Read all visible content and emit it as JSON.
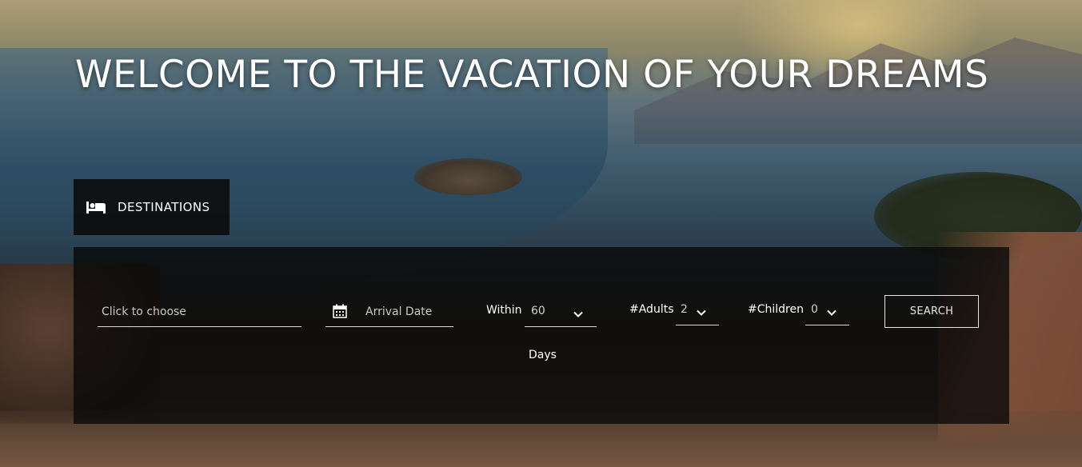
{
  "hero": {
    "title": "WELCOME TO THE VACATION OF YOUR DREAMS"
  },
  "tabs": [
    {
      "label": "DESTINATIONS",
      "icon": "bed-icon"
    }
  ],
  "search_form": {
    "destination": {
      "placeholder": "Click to choose",
      "value": ""
    },
    "arrival_date": {
      "placeholder": "Arrival Date",
      "value": "",
      "icon": "calendar-icon"
    },
    "within": {
      "label": "Within",
      "selected": "60",
      "suffix": "Days"
    },
    "adults": {
      "label": "#Adults",
      "selected": "2"
    },
    "children": {
      "label": "#Children",
      "selected": "0"
    },
    "search_button": {
      "label": "SEARCH"
    }
  },
  "colors": {
    "panel_bg": "#080808",
    "text": "#ffffff",
    "underline": "#d9d9d9"
  }
}
